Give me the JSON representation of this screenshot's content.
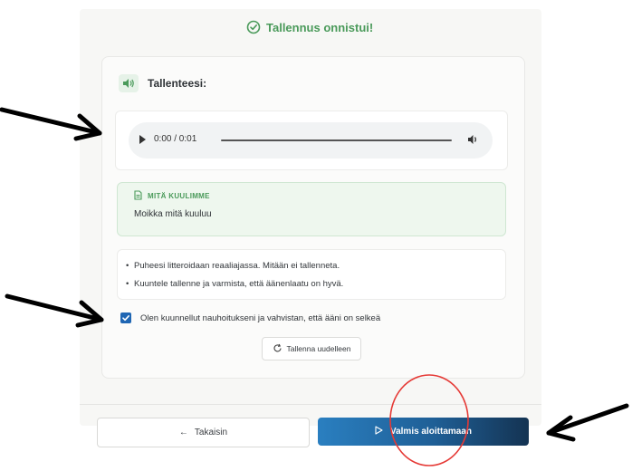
{
  "status": {
    "success_text": "Tallennus onnistui!"
  },
  "recording": {
    "heading": "Tallenteesi:",
    "player": {
      "time": "0:00 / 0:01",
      "progress": 0
    }
  },
  "transcript": {
    "title": "MITÄ KUULIMME",
    "text": "Moikka mitä kuuluu"
  },
  "info": {
    "bullets": [
      "Puheesi litteroidaan reaaliajassa. Mitään ei tallenneta.",
      "Kuuntele tallenne ja varmista, että äänenlaatu on hyvä."
    ]
  },
  "confirmation": {
    "label": "Olen kuunnellut nauhoitukseni ja vahvistan, että ääni on selkeä",
    "checked": true
  },
  "buttons": {
    "rerecord": "Tallenna uudelleen",
    "back": "Takaisin",
    "ready": "Valmis aloittamaan"
  },
  "icons": [
    "check-circle-icon",
    "speaker-icon",
    "play-icon",
    "volume-icon",
    "document-icon",
    "checkmark-icon",
    "refresh-icon",
    "arrow-left-icon",
    "play-outline-icon"
  ],
  "colors": {
    "success_green": "#4a9a5a",
    "primary_blue": "#1f5f96",
    "checkbox_blue": "#1f66b3",
    "annotation_red": "#e53935"
  }
}
